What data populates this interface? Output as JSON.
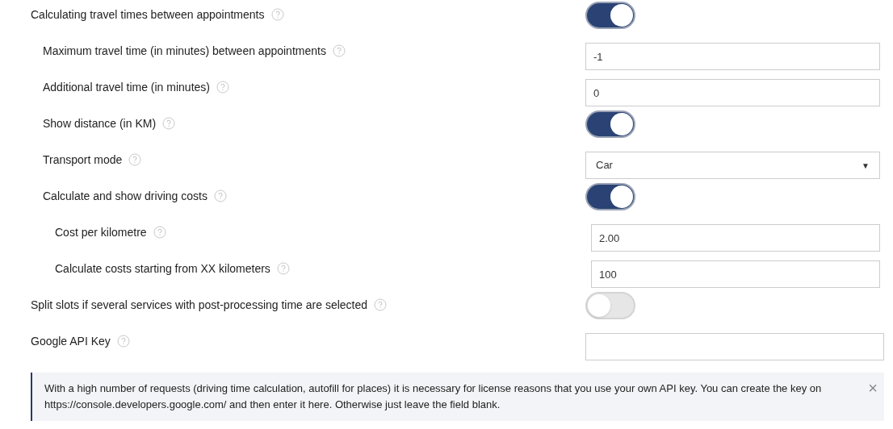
{
  "settings": [
    {
      "kind": "toggle",
      "label": "Calculating travel times between appointments",
      "on": true,
      "children": [
        {
          "kind": "input",
          "label": "Maximum travel time (in minutes) between appointments",
          "value": "-1"
        },
        {
          "kind": "input",
          "label": "Additional travel time (in minutes)",
          "value": "0"
        },
        {
          "kind": "toggle",
          "label": "Show distance (in KM)",
          "on": true
        },
        {
          "kind": "select",
          "label": "Transport mode",
          "value": "Car",
          "caret": "▼"
        },
        {
          "kind": "toggle",
          "label": "Calculate and show driving costs",
          "on": true,
          "children": [
            {
              "kind": "input",
              "label": "Cost per kilometre",
              "value": "2.00"
            },
            {
              "kind": "input",
              "label": "Calculate costs starting from XX kilometers",
              "value": "100"
            }
          ]
        }
      ]
    },
    {
      "kind": "toggle",
      "label": "Split slots if several services with post-processing time are selected",
      "on": false
    },
    {
      "kind": "input",
      "label": "Google API Key"
    }
  ],
  "notice": {
    "text": "With a high number of requests (driving time calculation, autofill for places) it is necessary for license reasons that you use your own API key. You can create the key on https://console.developers.google.com/ and then enter it here. Otherwise just leave the field blank.",
    "close": "×"
  }
}
